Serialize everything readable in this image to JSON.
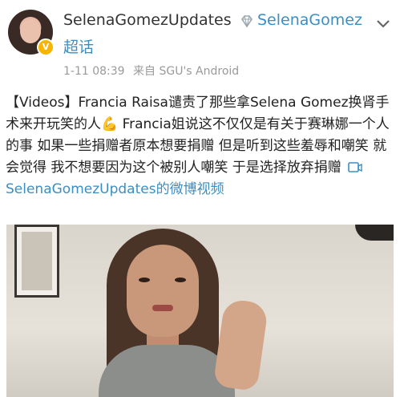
{
  "post": {
    "author": "SelenaGomezUpdates",
    "topic": "SelenaGomez",
    "super_topic": "超话",
    "timestamp": "1-11 08:39",
    "source": "来自 SGU's Android",
    "text_part1": "【Videos】Francia Raisa谴责了那些拿Selena Gomez换肾手术来开玩笑的人",
    "text_part2": " Francia姐说这不仅仅是有关于赛琳娜一个人的事 如果一些捐赠者原本想要捐赠 但是听到这些羞辱和嘲笑 就会觉得 我不想要因为这个被别人嘲笑 于是选择放弃捐赠 ",
    "video_link_text": "SelenaGomezUpdates的微博视频"
  },
  "icons": {
    "verified": "verified-badge-icon",
    "diamond": "diamond-icon",
    "more": "more-icon",
    "flex": "flexed-biceps-icon",
    "video": "video-icon"
  },
  "colors": {
    "link": "#3b8ec3",
    "verified_badge": "#f7b500"
  }
}
